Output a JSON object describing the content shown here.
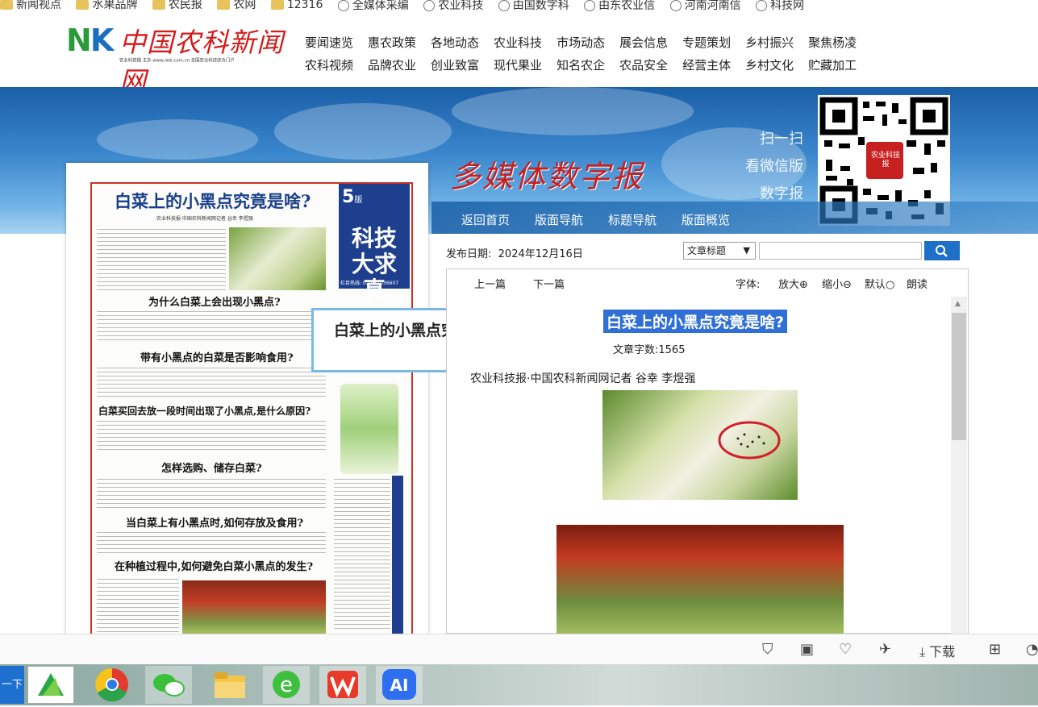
{
  "bookmarks": [
    "新闻视点",
    "水果品牌",
    "农民报",
    "农网",
    "12316",
    "全媒体采编",
    "农业科技",
    "由国数字科",
    "由东农业信",
    "河南河南信",
    "科技网"
  ],
  "header": {
    "logo_text": "中国农科新闻网",
    "logo_sub": "农业科技报 主办  www.nkb.com.cn  全国农业科技综合门户",
    "nav_row1": [
      "要闻速览",
      "惠农政策",
      "各地动态",
      "农业科技",
      "市场动态",
      "展会信息",
      "专题策划",
      "乡村振兴",
      "聚焦杨凌"
    ],
    "nav_row2": [
      "农科视频",
      "品牌农业",
      "创业致富",
      "现代果业",
      "知名农企",
      "农品安全",
      "经营主体",
      "乡村文化",
      "贮藏加工"
    ]
  },
  "banner": {
    "title": "多媒体数字报",
    "scan_lines": [
      "扫一扫",
      "看微信版",
      "数字报"
    ],
    "qr_label": "农业科技报"
  },
  "bluebar": {
    "items": [
      "返回首页",
      "版面导航",
      "标题导航",
      "版面概览"
    ]
  },
  "newspaper": {
    "headline": "白菜上的小黑点究竟是啥?",
    "byline": "农业科技报·中国农科新闻网记者 谷幸 李煜强",
    "edition_num": "5",
    "edition_unit": "版",
    "edition_banner": "科技大求真",
    "phone": "栏目热线: 029-87036607",
    "subheads": [
      "为什么白菜上会出现小黑点?",
      "带有小黑点的白菜是否影响食用?",
      "白菜买回去放一段时间出现了小黑点,是什么原因?",
      "怎样选购、储存白菜?",
      "当白菜上有小黑点时,如何存放及食用?",
      "在种植过程中,如何避免白菜小黑点的发生?"
    ]
  },
  "tooltip": "白菜上的小黑点究竟是啥?",
  "toolbar": {
    "date_label": "发布日期:",
    "date_value": "2024年12月16日",
    "select_value": "文章标题",
    "prev": "上一篇",
    "next": "下一篇",
    "font_label": "字体:",
    "zoom_in": "放大",
    "zoom_out": "缩小",
    "default": "默认",
    "read": "朗读"
  },
  "article": {
    "title": "白菜上的小黑点究竟是啥?",
    "word_count": "文章字数:1565",
    "byline": "农业科技报·中国农科新闻网记者 谷幸 李煜强"
  },
  "browserbar": {
    "download": "下载"
  },
  "taskbar": {
    "start_label": "一下"
  },
  "colors": {
    "accent_blue": "#1e6fc8",
    "logo_red": "#d51c1c",
    "logo_green": "#2a9a3b",
    "highlight": "#2f6fd6"
  }
}
